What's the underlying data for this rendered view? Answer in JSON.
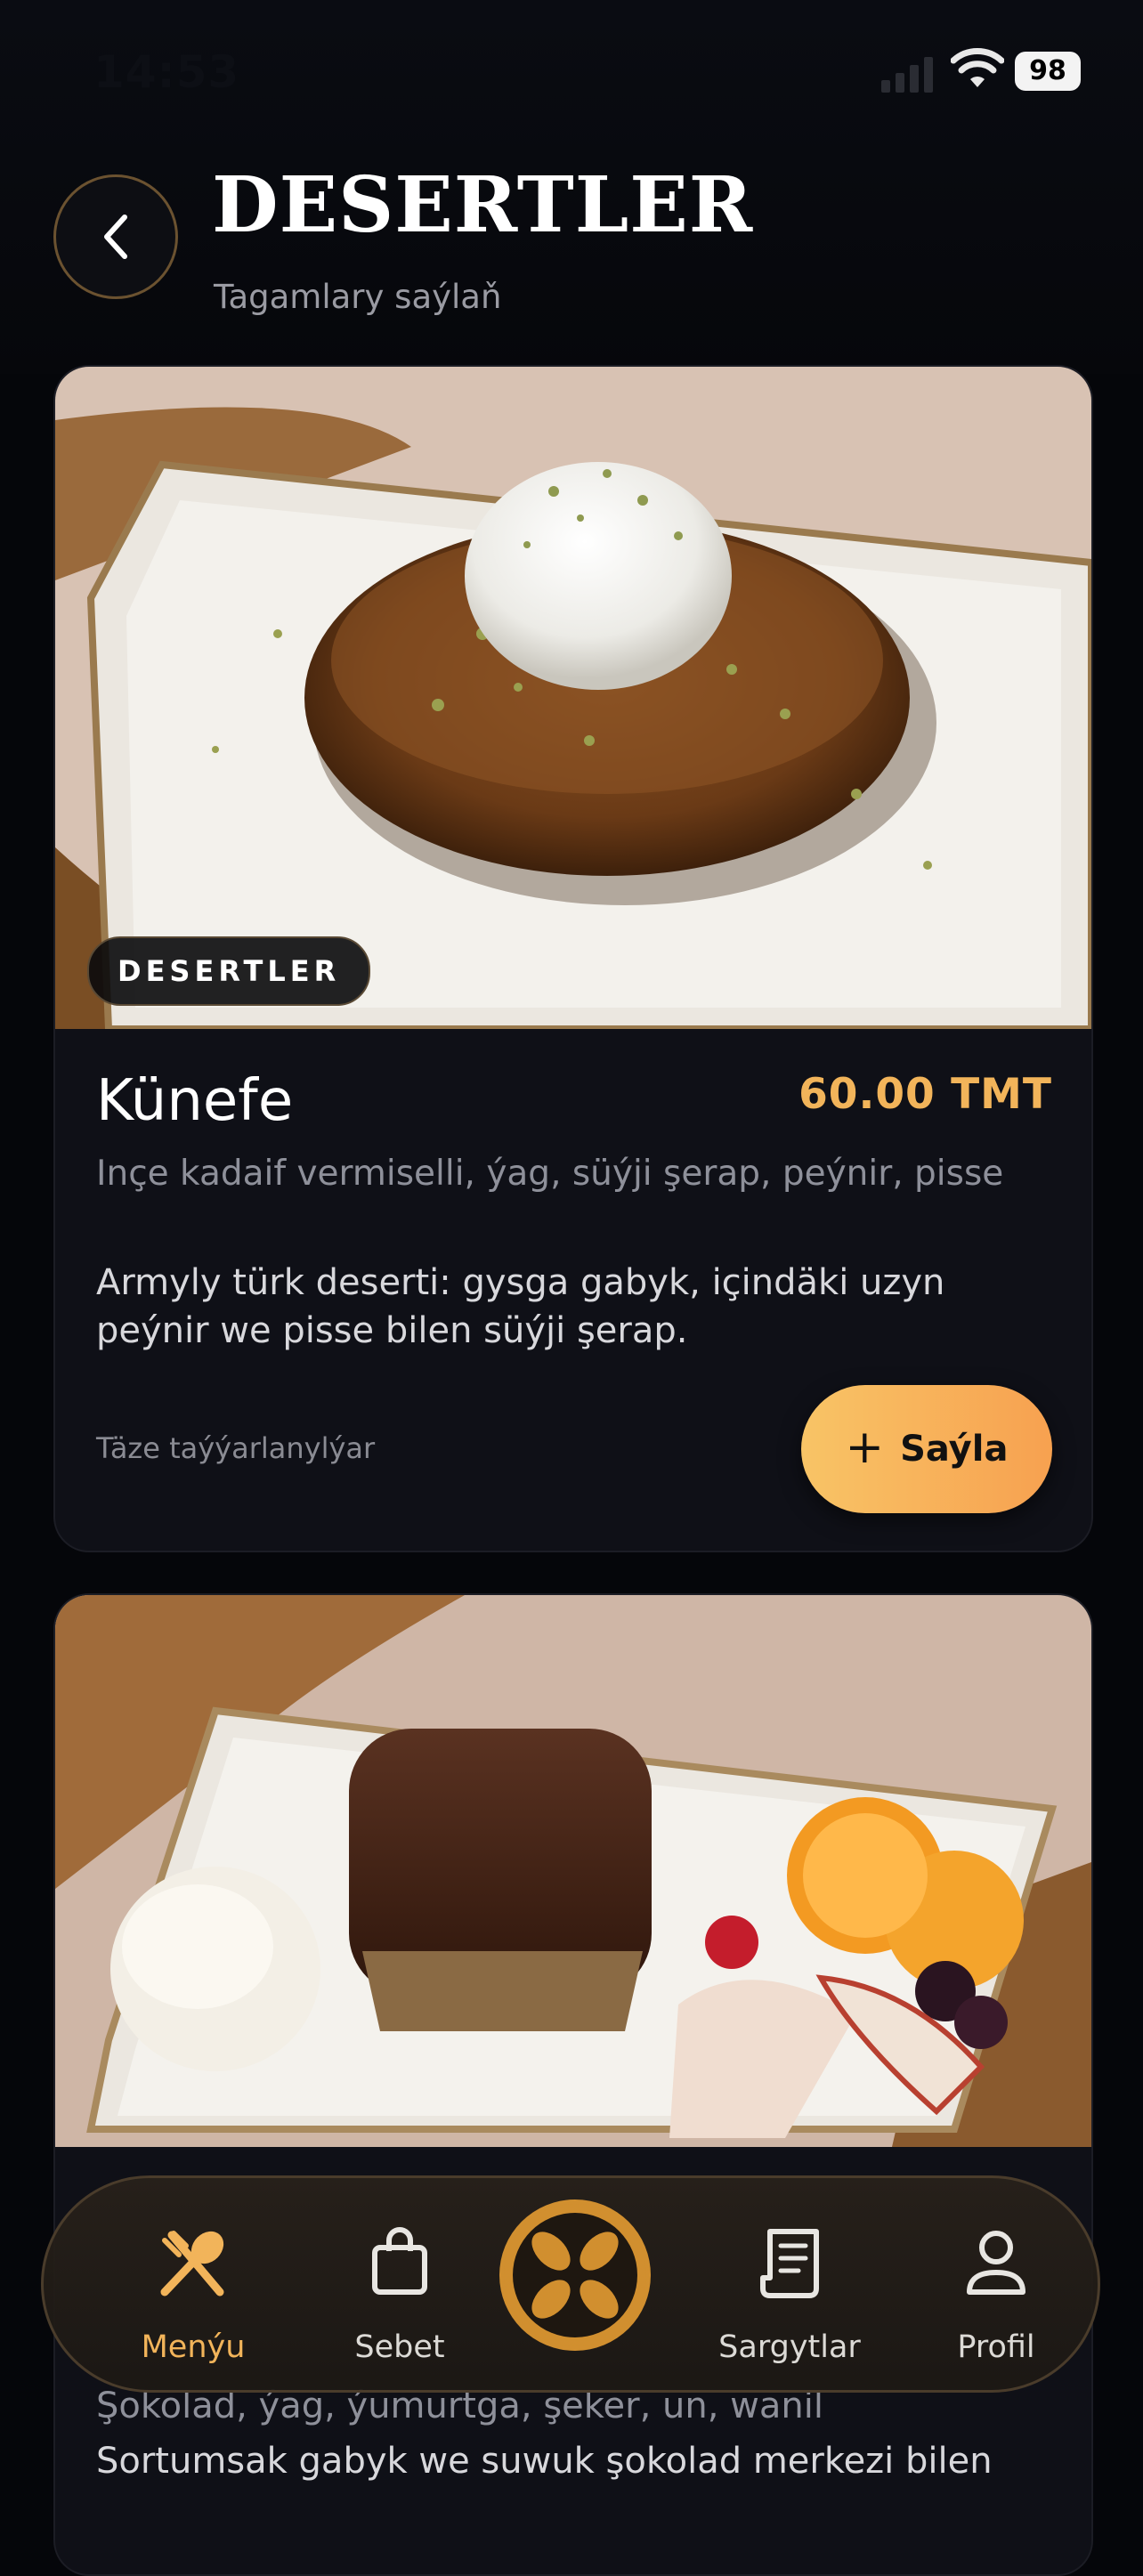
{
  "status_bar": {
    "time": "14:53",
    "battery": "98"
  },
  "header": {
    "title": "DESERTLER",
    "subtitle": "Tagamlary saýlaň"
  },
  "dishes": [
    {
      "category": "DESERTLER",
      "name": "Künefe",
      "price": "60.00 TMT",
      "ingredients": "Inçe kadaif vermiselli, ýag, süýji şerap, peýnir, pisse",
      "description": "Armyly türk deserti: gysga gabyk, içindäki uzyn peýnir we pisse bilen süýji şerap.",
      "note": "Täze taýýarlanylýar",
      "add_label": "Saýla"
    },
    {
      "ingredients": "Şokolad, ýag, ýumurtga, şeker, un, wanil",
      "description": "Sortumsak gabyk we suwuk şokolad merkezi bilen"
    }
  ],
  "bottom_nav": {
    "items": [
      {
        "label": "Menýu",
        "icon": "spoon-fork-icon"
      },
      {
        "label": "Sebet",
        "icon": "shopping-bag-icon"
      },
      {
        "label": "Sargytlar",
        "icon": "receipt-icon"
      },
      {
        "label": "Profil",
        "icon": "user-icon"
      }
    ]
  },
  "colors": {
    "accent": "#f2b45a",
    "background": "#05060a",
    "card": "#0f1017"
  }
}
